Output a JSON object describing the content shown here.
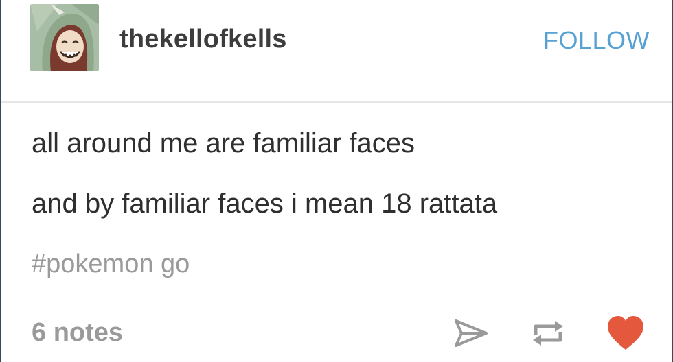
{
  "post": {
    "blog_name": "thekellofkells",
    "follow_label": "FOLLOW",
    "body_lines": [
      "all around me are familiar faces",
      "and by familiar faces i mean 18 rattata"
    ],
    "tags": [
      "#pokemon go"
    ],
    "notes_label": "6 notes"
  },
  "icons": {
    "share": "share-icon",
    "reblog": "reblog-icon",
    "like": "heart-icon"
  },
  "colors": {
    "follow": "#57a2d2",
    "text": "#2f2f2f",
    "muted": "#9a9a9a",
    "like": "#e4593e",
    "avatar_bg": "#9fb59c"
  }
}
